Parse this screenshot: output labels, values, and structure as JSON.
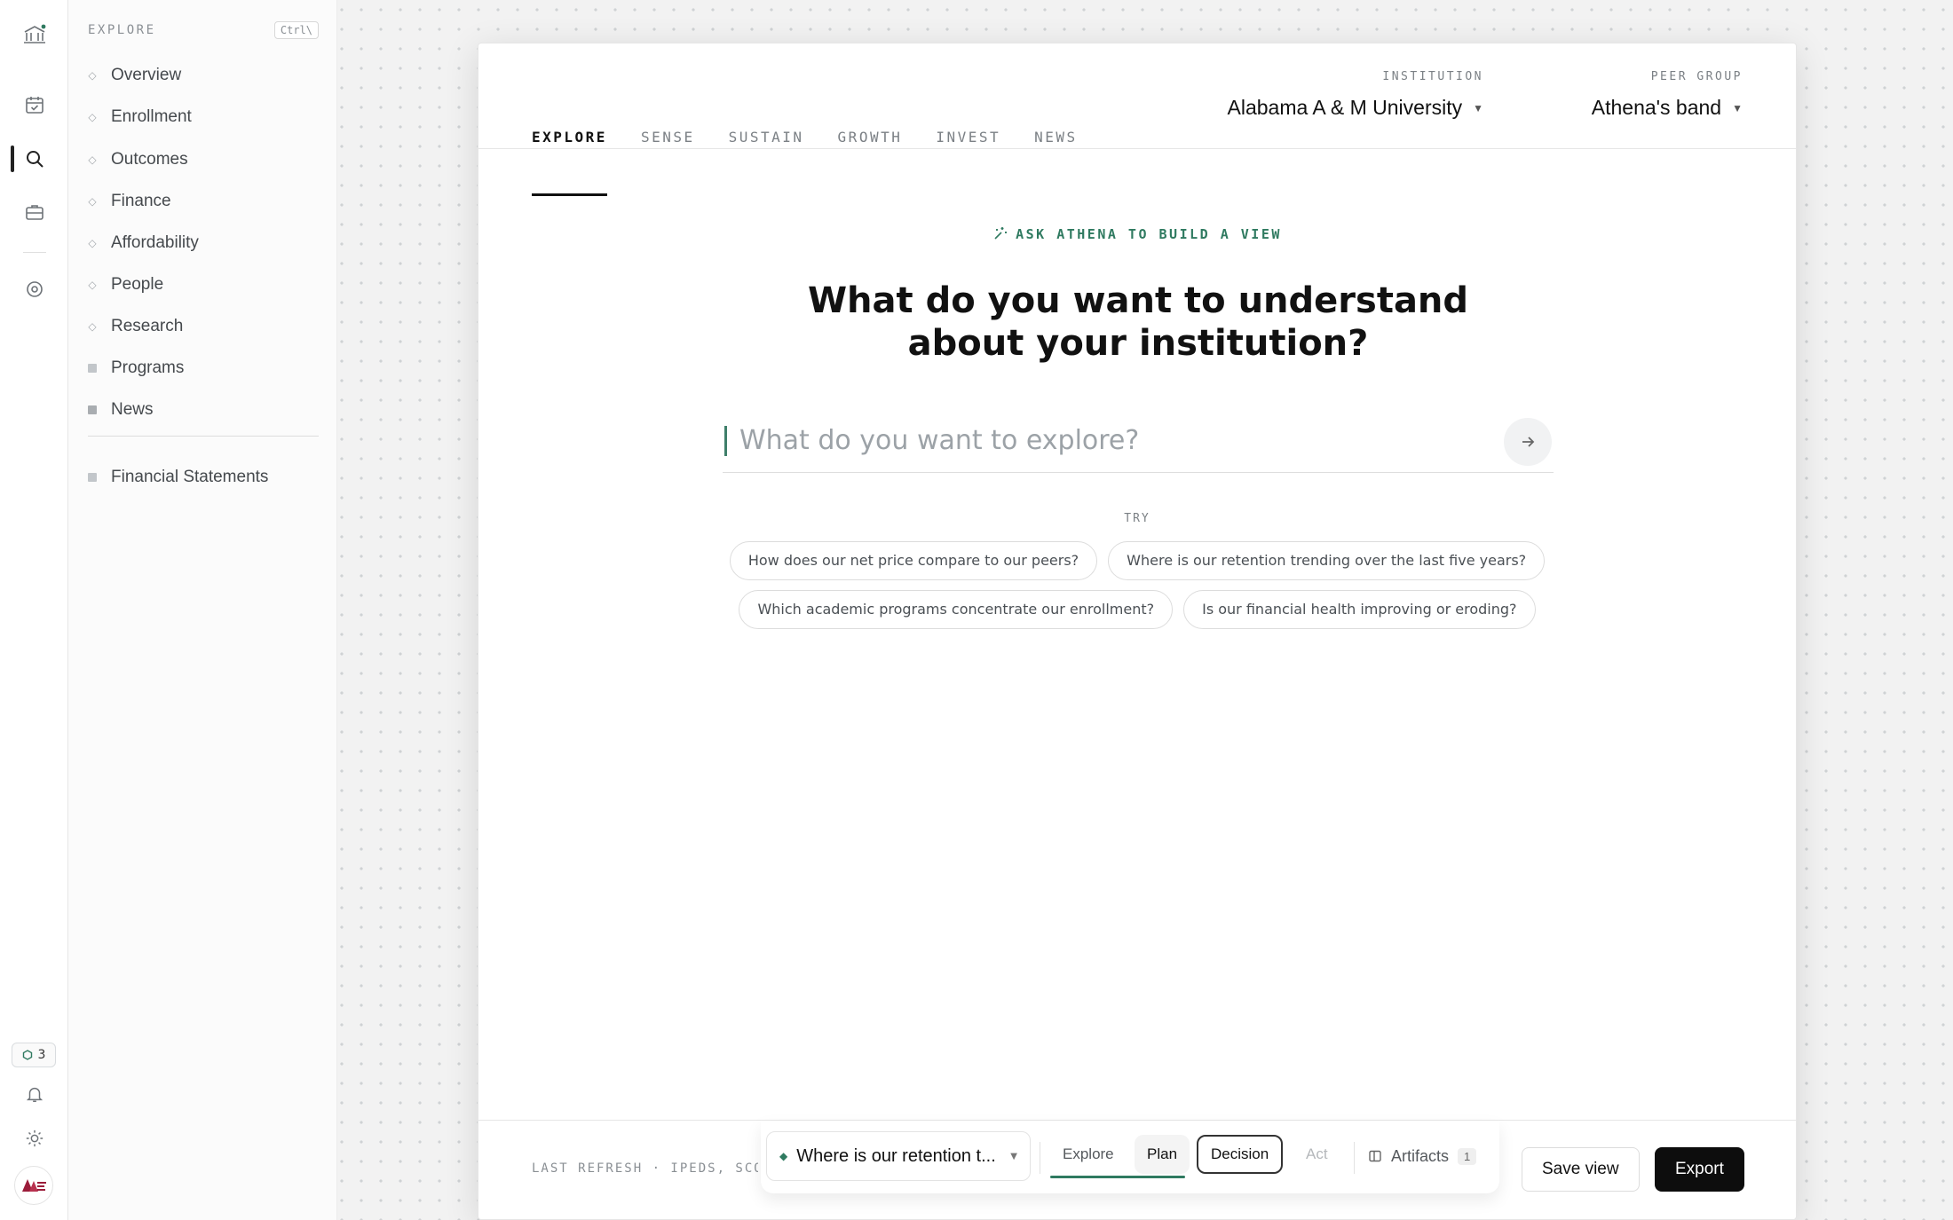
{
  "rail": {
    "notification_count": "3"
  },
  "sidebar": {
    "title": "EXPLORE",
    "shortcut": "Ctrl\\",
    "items": [
      {
        "label": "Overview"
      },
      {
        "label": "Enrollment"
      },
      {
        "label": "Outcomes"
      },
      {
        "label": "Finance"
      },
      {
        "label": "Affordability"
      },
      {
        "label": "People"
      },
      {
        "label": "Research"
      },
      {
        "label": "Programs"
      },
      {
        "label": "News"
      }
    ],
    "extra_items": [
      {
        "label": "Financial Statements"
      }
    ]
  },
  "tabs": [
    {
      "label": "EXPLORE"
    },
    {
      "label": "SENSE"
    },
    {
      "label": "SUSTAIN"
    },
    {
      "label": "GROWTH"
    },
    {
      "label": "INVEST"
    },
    {
      "label": "NEWS"
    }
  ],
  "institution": {
    "caption": "INSTITUTION",
    "value": "Alabama A & M University"
  },
  "peer_group": {
    "caption": "PEER GROUP",
    "value": "Athena's band"
  },
  "prompt": {
    "eyebrow": "ASK ATHENA TO BUILD A VIEW",
    "headline": "What do you want to understand about your institution?",
    "placeholder": "What do you want to explore?",
    "try_label": "TRY",
    "suggestions": [
      "How does our net price compare to our peers?",
      "Where is our retention trending over the last five years?",
      "Which academic programs concentrate our enrollment?",
      "Is our financial health improving or eroding?"
    ]
  },
  "footer": {
    "refresh": "LAST REFRESH · IPEDS, SCOR",
    "thread": "Where is our retention t...",
    "stages": [
      "Explore",
      "Plan",
      "Decision",
      "Act"
    ],
    "artifacts_label": "Artifacts",
    "artifacts_count": "1",
    "save_label": "Save view",
    "export_label": "Export"
  },
  "colors": {
    "accent": "#2f7a60",
    "primary_button": "#0d0d0d"
  }
}
